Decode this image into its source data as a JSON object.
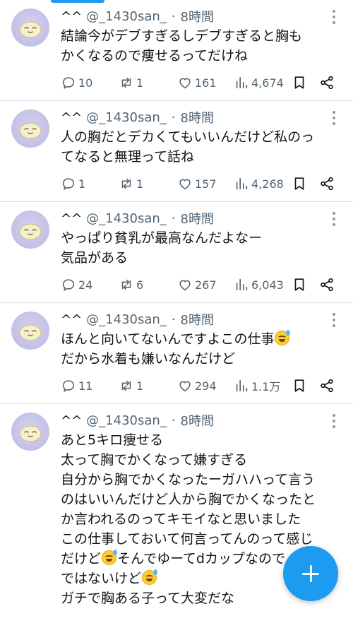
{
  "colors": {
    "accent": "#1d9bf0",
    "text": "#0f1419",
    "muted": "#536471",
    "avatar_bg": "#c8c5ea"
  },
  "icons": {
    "reply": "reply-icon",
    "retweet": "retweet-icon",
    "like": "heart-icon",
    "views": "views-icon",
    "bookmark": "bookmark-icon",
    "share": "share-icon",
    "more": "more-icon",
    "compose": "plus-icon"
  },
  "tweets": [
    {
      "display_name": "^^",
      "handle": "@_1430san_",
      "separator": "·",
      "time": "8時間",
      "lines": [
        "結論今がデブすぎるしデブすぎると胸も",
        "かくなるので痩せるってだけね"
      ],
      "replies": "10",
      "retweets": "1",
      "likes": "161",
      "views": "4,674"
    },
    {
      "display_name": "^^",
      "handle": "@_1430san_",
      "separator": "·",
      "time": "8時間",
      "lines": [
        "人の胸だとデカくてもいいんだけど私のっ",
        "てなると無理って話ね"
      ],
      "replies": "1",
      "retweets": "1",
      "likes": "157",
      "views": "4,268"
    },
    {
      "display_name": "^^",
      "handle": "@_1430san_",
      "separator": "·",
      "time": "8時間",
      "lines": [
        "やっぱり貧乳が最高なんだよなー",
        "気品がある"
      ],
      "replies": "24",
      "retweets": "6",
      "likes": "267",
      "views": "6,043"
    },
    {
      "display_name": "^^",
      "handle": "@_1430san_",
      "separator": "·",
      "time": "8時間",
      "lines": [
        "ほんと向いてないんですよこの仕事",
        "だから水着も嫌いなんだけど"
      ],
      "replies": "11",
      "retweets": "1",
      "likes": "294",
      "views": "1.1万"
    },
    {
      "display_name": "^^",
      "handle": "@_1430san_",
      "separator": "·",
      "time": "8時間",
      "lines": [
        "あと5キロ痩せる",
        "太って胸でかくなって嫌すぎる",
        "自分から胸でかくなったーガハハって言う",
        "のはいいんだけど人から胸でかくなったと",
        "か言われるのってキモイなと思いました",
        "この仕事しておいて何言ってんのって感じ",
        "だけど",
        "そんでゆーてdカップなので",
        "ではないけど",
        "ガチで胸ある子って大変だな"
      ]
    }
  ]
}
